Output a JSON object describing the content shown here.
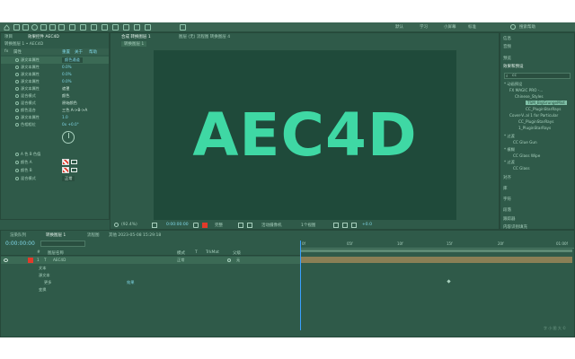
{
  "colors": {
    "app_bg": "#2f5a49",
    "viewer_bg": "#1f4a3a",
    "logo_text": "#3fd8a4",
    "highlight_blue": "#7fd6e6",
    "playhead": "#3aa0ff"
  },
  "toolbar": {
    "workspace_labels": [
      "默认",
      "学习",
      "小屏幕",
      "标准"
    ],
    "search_placeholder": "搜索帮助"
  },
  "project_panel": {
    "tab_label": "项目",
    "effect_tab_label": "效果控件 AEC4D",
    "layer_title": "转换图层 1 • AEC4D",
    "header_cols": [
      "重置",
      "关于",
      "帮助"
    ],
    "group_label": "属性",
    "properties": [
      {
        "name": "源文本属性",
        "value": "颜色通道"
      },
      {
        "name": "源文本属性",
        "value": "0.0%"
      },
      {
        "name": "源文本属性",
        "value": "0.0%"
      },
      {
        "name": "源文本属性",
        "value": "0.0%"
      },
      {
        "name": "源文本属性",
        "value": "遮罩"
      },
      {
        "name": "混合模式",
        "value": "颜色"
      },
      {
        "name": "混合模式",
        "value": "原始颜色"
      },
      {
        "name": "颜色混合",
        "value": "三色 A->B->A"
      },
      {
        "name": "源文本属性",
        "value": "1.0"
      },
      {
        "name": "色相相位",
        "value": "0x +0.0°"
      }
    ],
    "lower_properties": [
      {
        "name": "A 色 B 色值",
        "value": ""
      },
      {
        "name": "颜色 A",
        "value": ""
      },
      {
        "name": "颜色 B",
        "value": ""
      },
      {
        "name": "混合模式",
        "value": "正常"
      }
    ]
  },
  "composition_panel": {
    "tab_label": "合成 转换图层 1",
    "layer_tab": "图层 (无)  流程图  转换图层 4",
    "sub_tab": "转换图层 1",
    "main_text": "AEC4D",
    "zoom": "(92.4%)",
    "timecode": "0:00:00:00",
    "quality": "完整",
    "view": "活动摄像机",
    "views": "1个视图",
    "exposure": "+0.0"
  },
  "right_panel": {
    "top_items": [
      "信息",
      "音频",
      "预览"
    ],
    "effects_title": "效果和预设",
    "search_value": "cc",
    "tree": [
      "* 动画预设",
      "FX MAGIC PRO -...",
      "Chinese_Styles",
      "TSM_BigGrungeMist",
      "CC_PluginStarRays",
      "CC_PluginStarRays",
      "Cover-V..al 1 for Particular",
      "CC_PluginStarRays",
      "1_PluginStarRays",
      "* 过渡",
      "CC Glue Gun",
      "* 模糊",
      "CC Glass Wipe",
      "* 过渡",
      "CC Glass"
    ],
    "bottom_items": [
      "对齐",
      "库",
      "字符",
      "段落",
      "跟踪器",
      "内容识别填充",
      "画笔",
      "动态草图"
    ]
  },
  "timeline_panel": {
    "tabs": [
      "渲染队列",
      "转换图层 1",
      "流程图",
      "其他 2023-05-08 15:29:18"
    ],
    "timecode": "0:00:00:00",
    "column_headers": [
      "#",
      "图层名称",
      "模式",
      "T",
      "TrkMat",
      "父级"
    ],
    "layers": [
      {
        "index": "1",
        "name": "AEC4D",
        "mode": "正常",
        "parent": "无"
      }
    ],
    "sub_rows": [
      "文本",
      "源文本",
      "更多",
      "效果",
      "变换"
    ],
    "ruler_ticks": [
      "0f",
      "05f",
      "10f",
      "15f",
      "20f",
      "01:00f"
    ],
    "footer": "切换开关/模式"
  },
  "watermark": "字 小 图 大 ©"
}
